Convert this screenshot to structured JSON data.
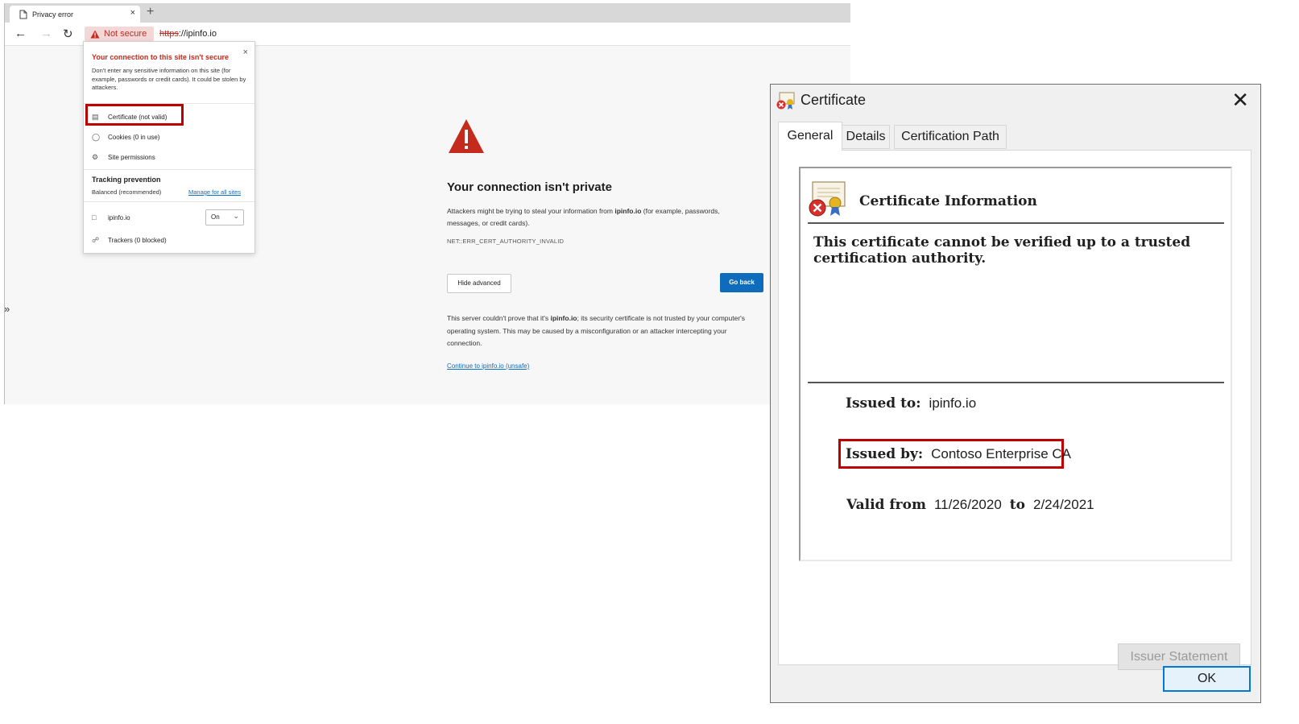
{
  "browser": {
    "tab_title": "Privacy error",
    "tab_close": "×",
    "new_tab": "+",
    "not_secure_label": "Not secure",
    "url_scheme": "https",
    "url_rest": "://ipinfo.io"
  },
  "flyout": {
    "title": "Your connection to this site isn't secure",
    "close": "×",
    "description": "Don't enter any sensitive information on this site (for example, passwords or credit cards). It could be stolen by attackers.",
    "items": [
      {
        "icon": "certificate-icon",
        "label": "Certificate (not valid)"
      },
      {
        "icon": "cookie-icon",
        "label": "Cookies (0 in use)"
      },
      {
        "icon": "gear-icon",
        "label": "Site permissions"
      }
    ],
    "tracking": {
      "title": "Tracking prevention",
      "mode": "Balanced (recommended)",
      "manage_link": "Manage for all sites",
      "site": "ipinfo.io",
      "toggle_value": "On",
      "trackers": "Trackers (0 blocked)"
    }
  },
  "error_page": {
    "title": "Your connection isn't private",
    "desc_prefix": "Attackers might be trying to steal your information from ",
    "desc_host": "ipinfo.io",
    "desc_suffix": " (for example, passwords, messages, or credit cards).",
    "error_code": "NET::ERR_CERT_AUTHORITY_INVALID",
    "hide_advanced": "Hide advanced",
    "go_back": "Go back",
    "detail_prefix": "This server couldn't prove that it's ",
    "detail_host": "ipinfo.io",
    "detail_suffix": "; its security certificate is not trusted by your computer's operating system. This may be caused by a misconfiguration or an attacker intercepting your connection.",
    "continue_link": "Continue to ipinfo.io (unsafe)"
  },
  "certificate_dialog": {
    "title": "Certificate",
    "close": "✕",
    "tabs": [
      "General",
      "Details",
      "Certification Path"
    ],
    "info_title": "Certificate Information",
    "warning": "This certificate cannot be verified up to a trusted certification authority.",
    "issued_to_label": "Issued to:",
    "issued_to": "ipinfo.io",
    "issued_by_label": "Issued by:",
    "issued_by": "Contoso Enterprise CA",
    "valid_from_label": "Valid from",
    "valid_from": "11/26/2020",
    "valid_to_label": "to",
    "valid_to": "2/24/2021",
    "issuer_statement": "Issuer Statement",
    "ok": "OK"
  },
  "colors": {
    "danger": "#c42b1c",
    "highlight": "#c00000",
    "link": "#0f6cbd",
    "primary_button": "#0f6cbd"
  }
}
